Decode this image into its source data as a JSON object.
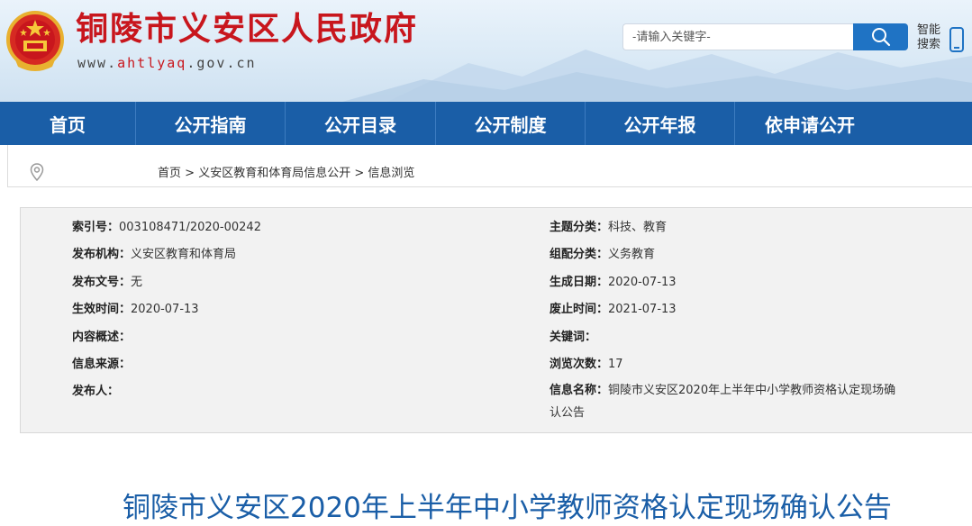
{
  "header": {
    "site_title": "铜陵市义安区人民政府",
    "site_url_prefix": "www.",
    "site_url_accent": "ahtlyaq",
    "site_url_suffix": ".gov.cn",
    "search_placeholder": "-请输入关键字-",
    "smart_search_line1": "智能",
    "smart_search_line2": "搜索",
    "icons": [
      "national-emblem",
      "search-icon",
      "mobile-phone-icon"
    ]
  },
  "nav": {
    "items": [
      "首页",
      "公开指南",
      "公开目录",
      "公开制度",
      "公开年报",
      "依申请公开"
    ]
  },
  "breadcrumb": {
    "icon": "location-pin-icon",
    "home": "首页",
    "sep": " > ",
    "section": "义安区教育和体育局信息公开",
    "current": "信息浏览"
  },
  "info": {
    "left": [
      {
        "label": "索引号：",
        "value": "003108471/2020-00242"
      },
      {
        "label": "发布机构：",
        "value": "义安区教育和体育局"
      },
      {
        "label": "发布文号：",
        "value": "无"
      },
      {
        "label": "生效时间：",
        "value": "2020-07-13"
      },
      {
        "label": "内容概述：",
        "value": ""
      },
      {
        "label": "信息来源：",
        "value": ""
      },
      {
        "label": "发布人：",
        "value": ""
      }
    ],
    "right": [
      {
        "label": "主题分类：",
        "value": "科技、教育"
      },
      {
        "label": "组配分类：",
        "value": "义务教育"
      },
      {
        "label": "生成日期：",
        "value": "2020-07-13"
      },
      {
        "label": "废止时间：",
        "value": "2021-07-13"
      },
      {
        "label": "关键词：",
        "value": ""
      },
      {
        "label": "浏览次数：",
        "value": "17"
      },
      {
        "label": "信息名称：",
        "value": "铜陵市义安区2020年上半年中小学教师资格认定现场确认公告"
      }
    ]
  },
  "article": {
    "title": "铜陵市义安区2020年上半年中小学教师资格认定现场确认公告"
  },
  "colors": {
    "brand_red": "#c8161d",
    "nav_blue": "#1a5ea7",
    "search_blue": "#1f73c4",
    "panel_gray": "#f2f2f2"
  }
}
